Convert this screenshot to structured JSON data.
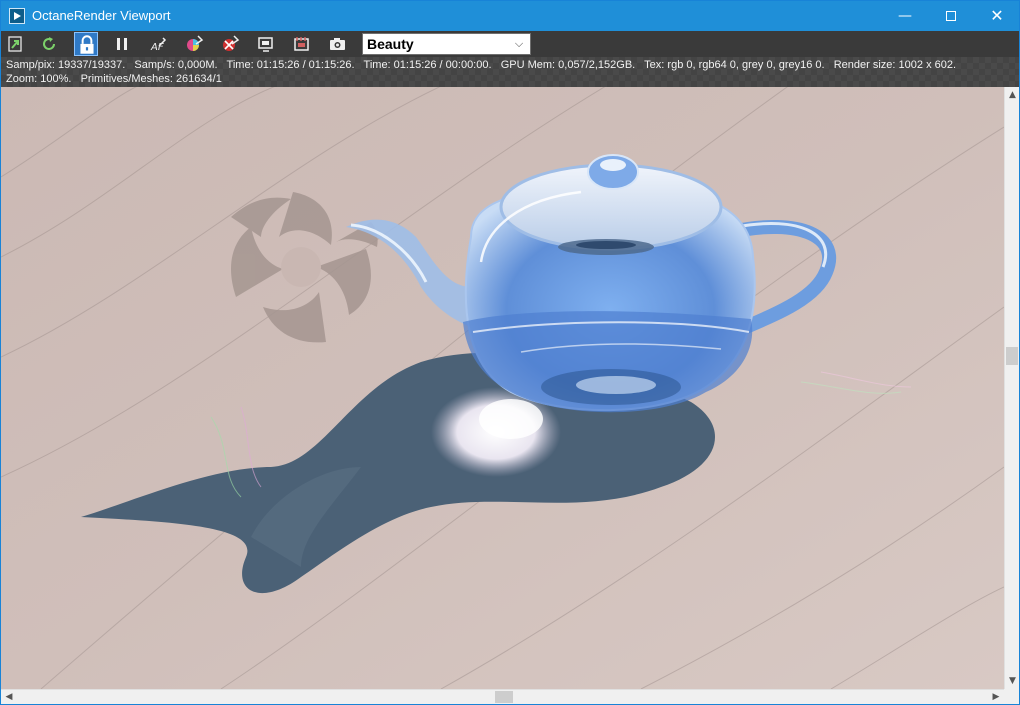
{
  "window": {
    "title": "OctaneRender Viewport",
    "controls": {
      "minimize": "—",
      "close": "✕"
    }
  },
  "toolbar": {
    "buttons": [
      {
        "icon": "export-render-icon"
      },
      {
        "icon": "restart-render-icon"
      },
      {
        "icon": "lock-viewport-icon",
        "active": true
      },
      {
        "icon": "pause-render-icon"
      },
      {
        "icon": "autofocus-picker-icon"
      },
      {
        "icon": "white-balance-picker-icon"
      },
      {
        "icon": "material-picker-icon"
      },
      {
        "icon": "object-picker-icon"
      },
      {
        "icon": "camera-target-picker-icon"
      },
      {
        "icon": "render-region-picker-icon"
      }
    ],
    "render_pass": {
      "selected": "Beauty"
    }
  },
  "info": {
    "line1": "Samp/pix: 19337/19337.   Samp/s: 0,000M.   Time: 01:15:26 / 01:15:26.   Time: 01:15:26 / 00:00:00.   GPU Mem: 0,057/2,152GB.   Tex: rgb 0, rgb64 0, grey 0, grey16 0.   Render size: 1002 x 602.",
    "line2": "Zoom: 100%.   Primitives/Meshes: 261634/1"
  },
  "scrollbars": {
    "up": "▲",
    "down": "▼",
    "left": "◀",
    "right": "▶"
  },
  "colors": {
    "titlebar": "#1f8fd8",
    "toolbar": "#3a3a3a",
    "floor": "#cdbbb6",
    "shadow": "#4d6479",
    "glass": "#6ea0e6",
    "logo": "#a59691"
  }
}
